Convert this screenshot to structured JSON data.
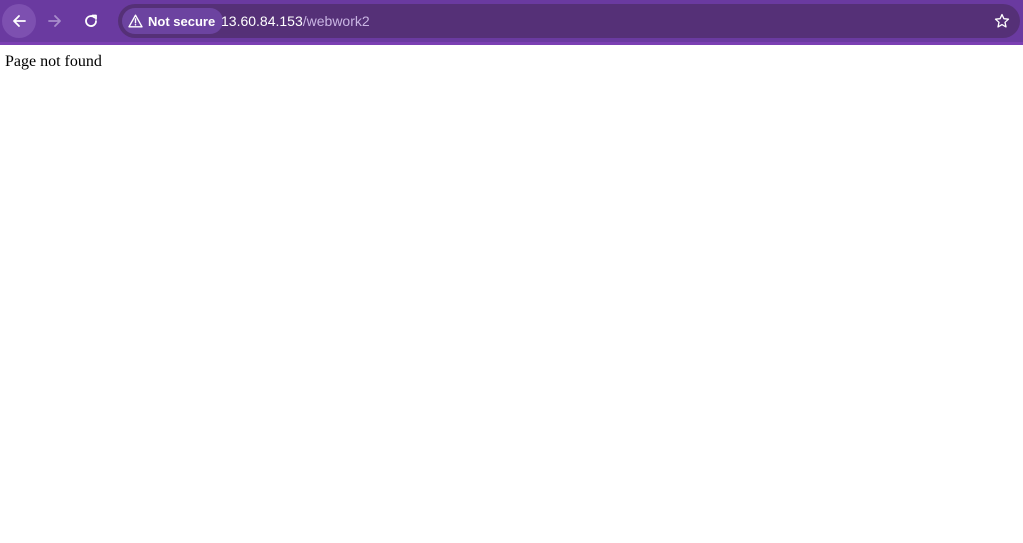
{
  "browser": {
    "theme_color": "#6a3aa0",
    "nav": {
      "back_icon": "arrow-left-icon",
      "forward_icon": "arrow-right-icon",
      "reload_icon": "reload-icon"
    },
    "omnibox": {
      "security_label": "Not secure",
      "security_icon": "warning-triangle-icon",
      "url_host": "13.60.84.153",
      "url_path": "/webwork2",
      "bookmark_icon": "star-icon"
    }
  },
  "page": {
    "message": "Page not found"
  }
}
